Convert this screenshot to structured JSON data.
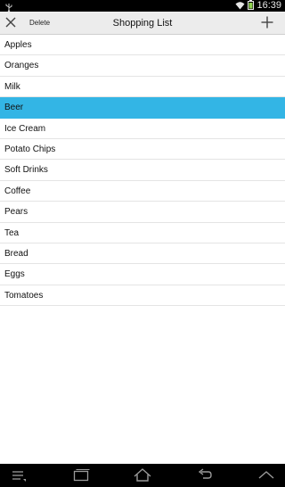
{
  "status_bar": {
    "time": "16:39",
    "icons": [
      "usb-icon",
      "wifi-icon",
      "battery-icon"
    ]
  },
  "action_bar": {
    "close_icon": "close-icon",
    "delete_label": "Delete",
    "title": "Shopping List",
    "add_icon": "plus-icon"
  },
  "list": {
    "items": [
      {
        "label": "Apples"
      },
      {
        "label": "Oranges"
      },
      {
        "label": "Milk"
      },
      {
        "label": "Beer",
        "selected": true
      },
      {
        "label": "Ice Cream"
      },
      {
        "label": "Potato Chips"
      },
      {
        "label": "Soft Drinks"
      },
      {
        "label": "Coffee"
      },
      {
        "label": "Pears"
      },
      {
        "label": "Tea"
      },
      {
        "label": "Bread"
      },
      {
        "label": "Eggs"
      },
      {
        "label": "Tomatoes"
      }
    ],
    "selected_color": "#33b5e5"
  },
  "nav_bar": {
    "buttons": [
      "menu-icon",
      "recent-apps-icon",
      "home-icon",
      "back-icon",
      "up-icon"
    ]
  }
}
